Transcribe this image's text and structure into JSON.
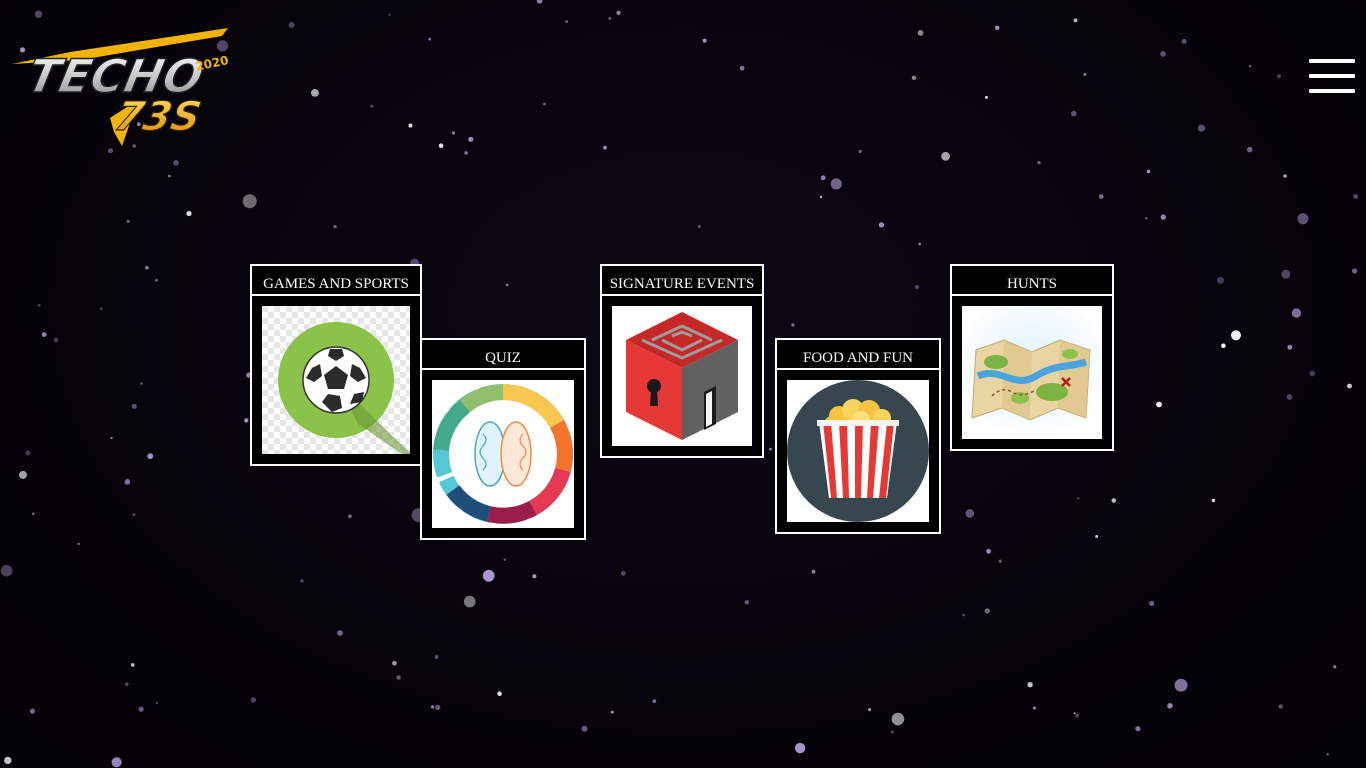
{
  "logo": {
    "text_main": "TECHO",
    "text_sub": "73S",
    "year": "2020"
  },
  "menu": {
    "icon": "hamburger-menu-icon"
  },
  "events": [
    {
      "label": "GAMES AND SPORTS",
      "icon": "soccer-ball-icon"
    },
    {
      "label": "QUIZ",
      "icon": "brain-wheel-icon"
    },
    {
      "label": "SIGNATURE EVENTS",
      "icon": "maze-cube-icon"
    },
    {
      "label": "FOOD AND FUN",
      "icon": "popcorn-icon"
    },
    {
      "label": "HUNTS",
      "icon": "treasure-map-icon"
    }
  ],
  "colors": {
    "background": "#05030a",
    "card_border": "#ffffff",
    "logo_silver": "#d9d9d9",
    "logo_gold": "#f2b400"
  }
}
